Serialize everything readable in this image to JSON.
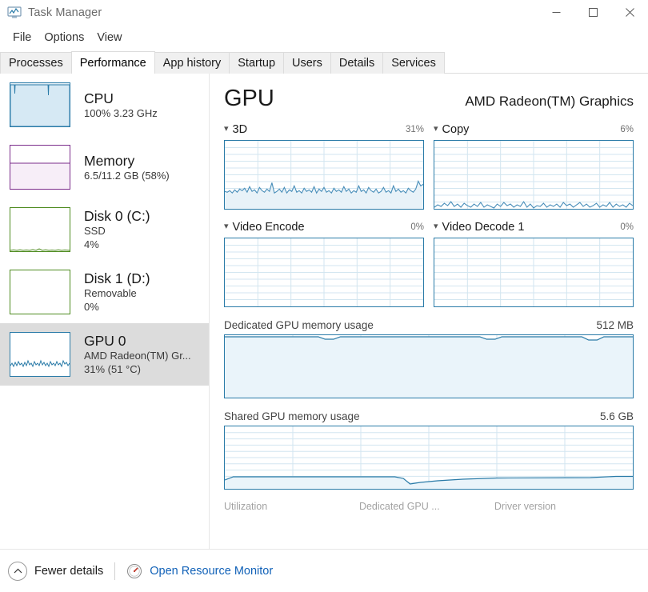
{
  "window": {
    "title": "Task Manager",
    "icon": "task-manager-icon",
    "controls": {
      "minimize": "—",
      "maximize": "□",
      "close": "✕"
    }
  },
  "menu": {
    "items": [
      "File",
      "Options",
      "View"
    ]
  },
  "tabs": {
    "items": [
      "Processes",
      "Performance",
      "App history",
      "Startup",
      "Users",
      "Details",
      "Services"
    ],
    "active": "Performance"
  },
  "sidebar": {
    "items": [
      {
        "title": "CPU",
        "sub1": "100%  3.23 GHz",
        "sub2": "",
        "accent": "#2a7ba8",
        "selected": false
      },
      {
        "title": "Memory",
        "sub1": "6.5/11.2 GB (58%)",
        "sub2": "",
        "accent": "#7b2d8b",
        "selected": false
      },
      {
        "title": "Disk 0 (C:)",
        "sub1": "SSD",
        "sub2": "4%",
        "accent": "#4e8b1f",
        "selected": false
      },
      {
        "title": "Disk 1 (D:)",
        "sub1": "Removable",
        "sub2": "0%",
        "accent": "#4e8b1f",
        "selected": false
      },
      {
        "title": "GPU 0",
        "sub1": "AMD Radeon(TM) Gr...",
        "sub2": "31%  (51 °C)",
        "accent": "#2a7ba8",
        "selected": true
      }
    ]
  },
  "main": {
    "title": "GPU",
    "device": "AMD Radeon(TM) Graphics",
    "engines": [
      {
        "label": "3D",
        "value": "31%"
      },
      {
        "label": "Copy",
        "value": "6%"
      },
      {
        "label": "Video Encode",
        "value": "0%"
      },
      {
        "label": "Video Decode 1",
        "value": "0%"
      }
    ],
    "memory": [
      {
        "label": "Dedicated GPU memory usage",
        "value": "512 MB"
      },
      {
        "label": "Shared GPU memory usage",
        "value": "5.6 GB"
      }
    ],
    "stats_clipped": [
      "Utilization",
      "Dedicated GPU ...",
      "Driver version"
    ]
  },
  "footer": {
    "fewer_details": "Fewer details",
    "open_resource_monitor": "Open Resource Monitor"
  },
  "chart_data": [
    {
      "type": "line",
      "title": "3D",
      "ylabel": "%",
      "ylim": [
        0,
        100
      ],
      "current": 31,
      "grid": true,
      "values": [
        26,
        24,
        27,
        25,
        29,
        24,
        28,
        30,
        26,
        34,
        24,
        28,
        25,
        31,
        26,
        29,
        24,
        27,
        25,
        38,
        24,
        26,
        29,
        25,
        31,
        24,
        28,
        26,
        34,
        25,
        27,
        24,
        30,
        26,
        28,
        25,
        33,
        24,
        29,
        26,
        31,
        25,
        27,
        24,
        30,
        26,
        28,
        25,
        32,
        26,
        29,
        24,
        27,
        25,
        34,
        26,
        28,
        24,
        31,
        27,
        25,
        29,
        24,
        28,
        26,
        31,
        25,
        27,
        24,
        33,
        26,
        29,
        25,
        28,
        24,
        30,
        27,
        25,
        29,
        40,
        34,
        30,
        28,
        31,
        33,
        36
      ]
    },
    {
      "type": "line",
      "title": "Copy",
      "ylabel": "%",
      "ylim": [
        0,
        100
      ],
      "current": 6,
      "grid": true,
      "values": [
        2,
        4,
        3,
        6,
        4,
        8,
        5,
        3,
        6,
        4,
        7,
        3,
        5,
        4,
        8,
        3,
        6,
        4,
        2,
        5,
        3,
        7,
        4,
        6,
        3,
        5,
        4,
        8,
        3,
        6,
        2,
        5,
        4,
        7,
        3,
        6,
        4,
        5,
        3,
        8,
        4,
        6,
        3,
        5,
        7,
        4,
        6,
        3,
        5,
        4,
        8,
        3,
        6,
        4,
        7,
        3,
        5,
        6,
        4,
        8,
        3,
        6,
        4,
        5,
        3,
        7,
        4,
        6,
        5,
        3,
        8,
        4,
        6,
        3,
        5,
        4,
        7,
        3,
        6,
        4,
        8,
        5,
        3,
        6,
        4,
        7
      ]
    },
    {
      "type": "line",
      "title": "Video Encode",
      "ylabel": "%",
      "ylim": [
        0,
        100
      ],
      "current": 0,
      "grid": true,
      "values": []
    },
    {
      "type": "line",
      "title": "Video Decode 1",
      "ylabel": "%",
      "ylim": [
        0,
        100
      ],
      "current": 0,
      "grid": true,
      "values": []
    },
    {
      "type": "area",
      "title": "Dedicated GPU memory usage",
      "ylabel": "MB",
      "ylim": [
        0,
        512
      ],
      "current": 512,
      "grid": true,
      "values": [
        512,
        512,
        512,
        512,
        512,
        512,
        512,
        512,
        512,
        512,
        512,
        512,
        512,
        512,
        512,
        512,
        512,
        512,
        512,
        512,
        506,
        500,
        505,
        512,
        512,
        512,
        512,
        512,
        512,
        512,
        512,
        512,
        512,
        512,
        512,
        512,
        512,
        512,
        512,
        512,
        512,
        512,
        512,
        512,
        512,
        512,
        512,
        512,
        512,
        512,
        512,
        512,
        505,
        500,
        506,
        512,
        512,
        512,
        512,
        512,
        512,
        512,
        512,
        512,
        512,
        512,
        512,
        512,
        512,
        512,
        512,
        512,
        512,
        512,
        512,
        500,
        496,
        504,
        512,
        512,
        512,
        512,
        512,
        512,
        512,
        512
      ]
    },
    {
      "type": "area",
      "title": "Shared GPU memory usage",
      "ylabel": "GB",
      "ylim": [
        0,
        5.6
      ],
      "current": 0.62,
      "grid": true,
      "values": [
        0.5,
        0.62,
        0.62,
        0.62,
        0.62,
        0.62,
        0.62,
        0.62,
        0.62,
        0.62,
        0.62,
        0.62,
        0.62,
        0.62,
        0.62,
        0.62,
        0.62,
        0.62,
        0.62,
        0.62,
        0.62,
        0.62,
        0.62,
        0.62,
        0.62,
        0.62,
        0.62,
        0.62,
        0.62,
        0.62,
        0.62,
        0.62,
        0.62,
        0.62,
        0.62,
        0.62,
        0.62,
        0.62,
        0.62,
        0.62,
        0.62,
        0.62,
        0.55,
        0.42,
        0.38,
        0.4,
        0.43,
        0.45,
        0.46,
        0.47,
        0.48,
        0.49,
        0.5,
        0.51,
        0.53,
        0.55,
        0.57,
        0.59,
        0.6,
        0.61,
        0.61,
        0.61,
        0.61,
        0.61,
        0.61,
        0.61,
        0.61,
        0.61,
        0.61,
        0.61,
        0.61,
        0.61,
        0.61,
        0.61,
        0.61,
        0.61,
        0.61,
        0.61,
        0.61,
        0.61,
        0.61,
        0.62,
        0.64,
        0.65,
        0.65,
        0.65
      ]
    }
  ]
}
